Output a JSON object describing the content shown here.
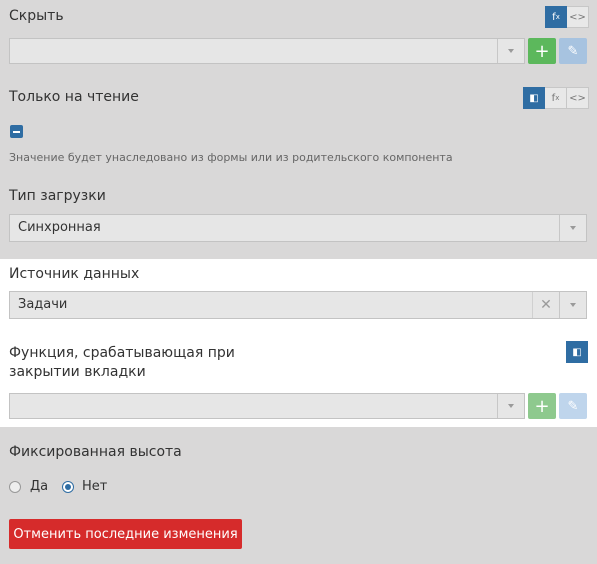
{
  "hide": {
    "label": "Скрыть"
  },
  "readonly": {
    "label": "Только на чтение",
    "hint": "Значение будет унаследовано из формы или из родительского компонента"
  },
  "load_type": {
    "label": "Тип загрузки",
    "value": "Синхронная"
  },
  "data_source": {
    "label": "Источник данных",
    "value": "Задачи"
  },
  "close_function": {
    "label": "Функция, срабатывающая при закрытии вкладки",
    "value": ""
  },
  "fixed_height": {
    "label": "Фиксированная высота",
    "options": [
      "Да",
      "Нет"
    ],
    "selected": "Нет"
  },
  "revert_button": {
    "label": "Отменить последние изменения"
  },
  "icons": {
    "fx": "fx-icon",
    "code": "code-icon",
    "speaker": "speaker-icon",
    "plus": "plus-icon",
    "pencil": "pencil-icon",
    "clear": "clear-icon",
    "chevron": "chevron-down-icon"
  },
  "colors": {
    "accent": "#2f6da3",
    "green": "#5cb85c",
    "danger": "#d62b2b"
  }
}
